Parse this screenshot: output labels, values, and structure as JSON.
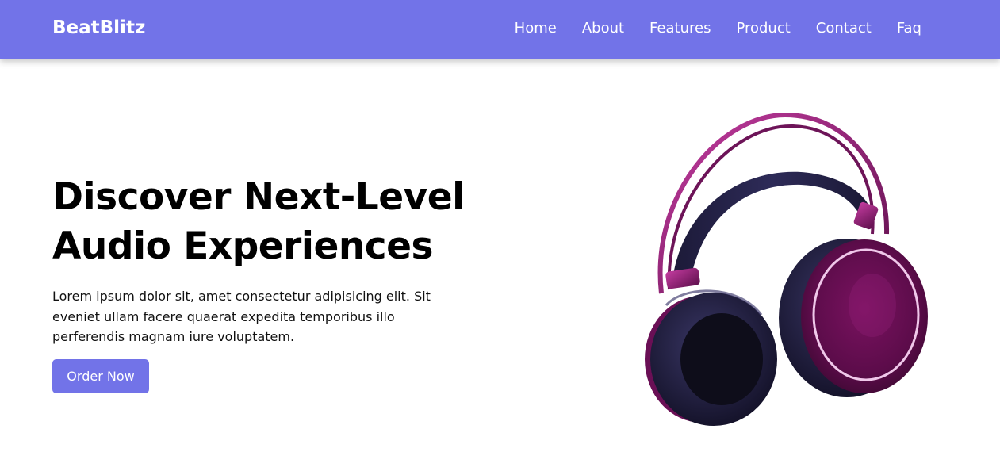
{
  "brand": {
    "name": "BeatBlitz"
  },
  "nav": {
    "items": [
      {
        "label": "Home"
      },
      {
        "label": "About"
      },
      {
        "label": "Features"
      },
      {
        "label": "Product"
      },
      {
        "label": "Contact"
      },
      {
        "label": "Faq"
      }
    ]
  },
  "hero": {
    "title_line1": "Discover Next-Level",
    "title_line2": "Audio Experiences",
    "description": "Lorem ipsum dolor sit, amet consectetur adipisicing elit. Sit eveniet ullam facere quaerat expedita temporibus illo perferendis magnam iure voluptatem.",
    "cta_label": "Order Now",
    "image": "headphones-image"
  },
  "colors": {
    "accent": "#7273e8",
    "headphone_magenta": "#8a1a6e",
    "headphone_navy": "#26234a"
  }
}
